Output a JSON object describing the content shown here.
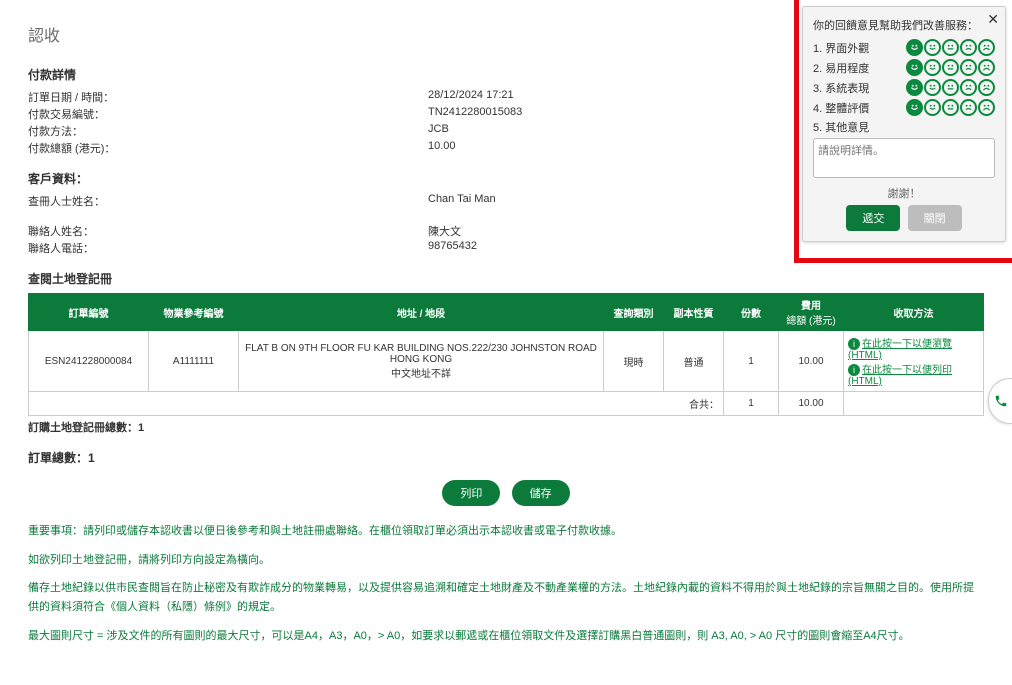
{
  "title": "認收",
  "payment": {
    "heading": "付款詳情",
    "rows": {
      "order_datetime_key": "訂單日期 / 時間：",
      "order_datetime_val": "28/12/2024 17:21",
      "txn_key": "付款交易編號：",
      "txn_val": "TN2412280015083",
      "method_key": "付款方法：",
      "method_val": "JCB",
      "total_key": "付款總額 (港元)：",
      "total_val": "10.00"
    }
  },
  "customer": {
    "heading": "客戶資料：",
    "searcher_key": "查冊人士姓名：",
    "searcher_val": "Chan Tai Man",
    "contact_name_key": "聯絡人姓名：",
    "contact_name_val": "陳大文",
    "contact_tel_key": "聯絡人電話：",
    "contact_tel_val": "98765432"
  },
  "order_section_heading": "查閱土地登記冊",
  "table": {
    "headers": {
      "order_no": "訂單編號",
      "prop_ref": "物業參考編號",
      "addr": "地址 / 地段",
      "enq_type": "查詢類別",
      "copy_nature": "副本性質",
      "copies": "份數",
      "fee_top": "費用",
      "fee_sub": "總額 (港元)",
      "collect": "收取方法"
    },
    "row": {
      "order_no": "ESN241228000084",
      "prop_ref": "A1111111",
      "addr1": "FLAT B ON 9TH FLOOR FU KAR BUILDING NOS.222/230 JOHNSTON ROAD",
      "addr2": "HONG KONG",
      "addr3": "中文地址不詳",
      "enq_type": "現時",
      "copy_nature": "普通",
      "copies": "1",
      "fee": "10.00",
      "link1": "在此按一下以便瀏覽 (HTML)",
      "link2": "在此按一下以便列印 (HTML)"
    },
    "totals": {
      "label": "合共：",
      "copies": "1",
      "fee": "10.00"
    }
  },
  "below": {
    "count_label": "訂購土地登記冊總數：1",
    "order_total_label": "訂單總數：1"
  },
  "buttons": {
    "print": "列印",
    "save": "儲存"
  },
  "notes": {
    "l1": "重要事項：請列印或儲存本認收書以便日後參考和與土地註冊處聯絡。在櫃位領取訂單必須出示本認收書或電子付款收據。",
    "l2": "如欲列印土地登記冊，請將列印方向設定為橫向。",
    "l3": "備存土地紀錄以供市民查閱旨在防止秘密及有欺詐成分的物業轉易，以及提供容易追溯和確定土地財產及不動產業權的方法。土地紀錄內載的資料不得用於與土地紀錄的宗旨無關之目的。使用所提供的資料須符合《個人資料（私隱）條例》的規定。",
    "l4": "最大圖則尺寸 = 涉及文件的所有圖則的最大尺寸，可以是A4，A3，A0，> A0，如要求以郵遞或在櫃位領取文件及選擇訂購黑白普通圖則，則 A3, A0, > A0 尺寸的圖則會縮至A4尺寸。"
  },
  "feedback": {
    "title": "你的回饋意見幫助我們改善服務：",
    "items": [
      "1.  界面外觀",
      "2.  易用程度",
      "3.  系統表現",
      "4.  整體評價",
      "5.  其他意見"
    ],
    "placeholder": "請說明詳情。",
    "thanks": "謝謝！",
    "submit": "遞交",
    "close": "關閉"
  }
}
